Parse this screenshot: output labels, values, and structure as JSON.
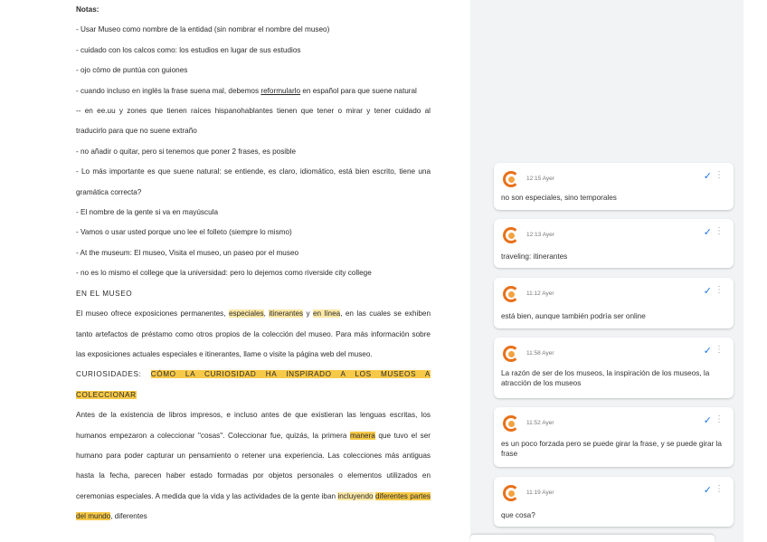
{
  "document": {
    "notes_title": "Notas:",
    "notes": [
      "- Usar Museo como nombre de la entidad (sin nombrar el nombre del museo)",
      "- cuidado con los calcos como: los estudios en lugar de sus estudios",
      "- ojo cómo de puntúa con guiones"
    ],
    "note4_a": "- cuando incluso en inglés la frase suena mal, debemos ",
    "note4_link": "reformularlo",
    "note4_b": " en español para que suene natural",
    "notes_more": [
      "-- en ee.uu y zones que tienen raíces hispanohablantes tienen que tener o mirar y tener cuidado al traducirlo para que no suene extraño",
      "- no añadir o quitar, pero si tenemos que poner 2 frases, es posible",
      "- Lo más importante es que suene natural: se entiende, es claro, idiomático, está bien escrito, tiene una gramática correcta?",
      "- El nombre de la gente si va en mayúscula",
      "- Vamos o usar usted porque uno lee el folleto (siempre lo mismo)",
      "- At the museum: El museo, Visita el museo, un paseo por el museo",
      "- no es lo mismo el college que la universidad: pero lo dejemos como riverside city college"
    ],
    "section_heading": "EN EL MUSEO",
    "para1_a": "El museo ofrece exposiciones permanentes, ",
    "para1_h1": "especiales",
    "para1_b": ", ",
    "para1_h2": "itinerantes",
    "para1_c": " y ",
    "para1_h3": "en línea",
    "para1_d": ", en las cuales se exhiben tanto artefactos de préstamo como otros propios de la colección del museo. Para más información sobre las exposiciones actuales especiales e itinerantes, llame o visite la página web del museo.",
    "heading2_a": "CURIOSIDADES: ",
    "heading2_h": "CÓMO LA CURIOSIDAD HA INSPIRADO A LOS MUSEOS A COLECCIONAR",
    "para2_a": "Antes de la existencia de libros impresos, e incluso antes de que existieran las lenguas escritas, los humanos empezaron a coleccionar \"cosas\". Coleccionar fue, quizás, la primera ",
    "para2_h": "manera",
    "para2_b": " que tuvo el ser humano para poder capturar un pensamiento o retener una experiencia. Las colecciones más antiguas hasta la fecha, parecen haber estado formadas por objetos personales o elementos utilizados en ceremonias especiales. A medida que la vida y las actividades de la gente iban ",
    "para2_h2": "incluyendo",
    "para2_c": " ",
    "para2_h3": "diferentes partes del mundo",
    "para2_d": ", diferentes"
  },
  "comments": [
    {
      "time": "12:15 Ayer",
      "text": "no son especiales, sino temporales"
    },
    {
      "time": "12:13 Ayer",
      "text": "traveling: itinerantes"
    },
    {
      "time": "11:12 Ayer",
      "text": "está bien, aunque también podría ser online"
    },
    {
      "time": "11:58 Ayer",
      "text": "La razón de ser de los museos, la inspiración de los museos, la atracción de los museos"
    },
    {
      "time": "11:52 Ayer",
      "text": "es un poco forzada pero se puede girar la frase, y se puede girar la frase"
    },
    {
      "time": "11:19 Ayer",
      "text": "que cosa?"
    }
  ],
  "icons": {
    "resolve": "check-icon",
    "more": "more-vert-icon"
  },
  "colors": {
    "highlight": "#fbe8a6",
    "highlight_strong": "#f7c948",
    "accent": "#1a73e8",
    "avatar": "#e8711a"
  }
}
